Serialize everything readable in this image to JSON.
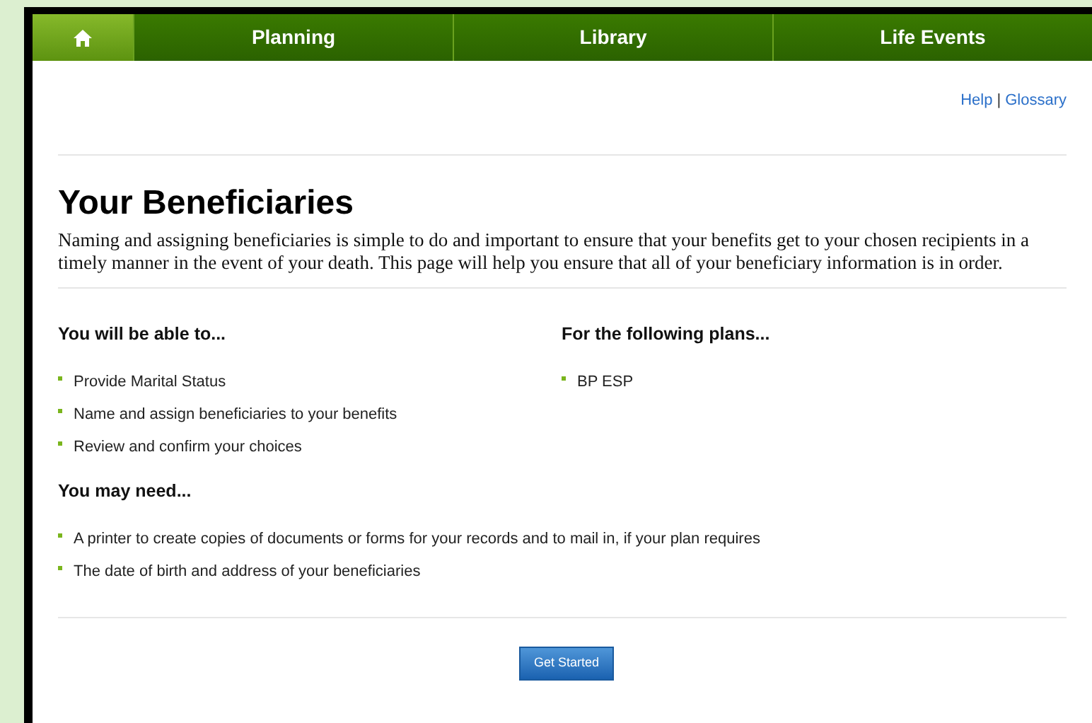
{
  "nav_tabs": [
    {
      "kind": "home",
      "selected": true
    },
    {
      "kind": "text",
      "label": "Planning",
      "selected": false
    },
    {
      "kind": "text",
      "label": "Library",
      "selected": false
    },
    {
      "kind": "text",
      "label": "Life Events",
      "selected": false
    }
  ],
  "links": [
    "Help",
    "Glossary"
  ],
  "link_separator": "|",
  "title": "Your Beneficiaries",
  "intro": "Naming and assigning beneficiaries is simple to do and important to ensure that your benefits get to your chosen recipients in a timely manner in the event of your death. This page will help you ensure that all of your beneficiary information is in order.",
  "able_to": {
    "heading": "You will be able to...",
    "items": [
      "Provide Marital Status",
      "Name and assign beneficiaries to your benefits",
      "Review and confirm your choices"
    ]
  },
  "plans": {
    "heading": "For the following plans...",
    "items": [
      "BP ESP"
    ]
  },
  "may_need": {
    "heading": "You may need...",
    "items": [
      "A printer to create copies of documents or forms for your records and to mail in, if your plan requires",
      "The date of birth and address of your beneficiaries"
    ]
  },
  "button": "Get Started"
}
